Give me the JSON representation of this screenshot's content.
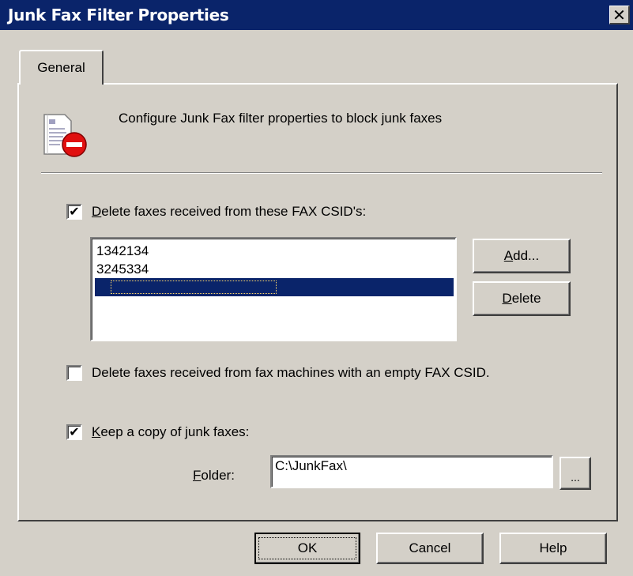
{
  "window": {
    "title": "Junk Fax Filter Properties",
    "close_glyph": "✕"
  },
  "tabs": [
    {
      "label": "General"
    }
  ],
  "header": {
    "description": "Configure Junk Fax filter properties to block junk faxes"
  },
  "csid_filter": {
    "checked": true,
    "label_prefix": "",
    "label_accel": "D",
    "label_rest": "elete faxes received from these FAX CSID's:",
    "items": [
      "1342134",
      "3245334"
    ],
    "add_accel": "A",
    "add_rest": "dd...",
    "delete_accel": "D",
    "delete_rest": "elete"
  },
  "empty_csid": {
    "checked": false,
    "label": "Delete faxes received from fax machines with an empty FAX CSID."
  },
  "keep_copy": {
    "checked": true,
    "label_accel": "K",
    "label_rest": "eep a copy of junk faxes:",
    "folder_accel": "F",
    "folder_rest": "older:",
    "folder_value": "C:\\JunkFax\\",
    "browse_label": "..."
  },
  "footer": {
    "ok": "OK",
    "cancel": "Cancel",
    "help": "Help"
  },
  "colors": {
    "titlebar": "#0a246a",
    "face": "#d4d0c8",
    "selection": "#0a246a"
  }
}
